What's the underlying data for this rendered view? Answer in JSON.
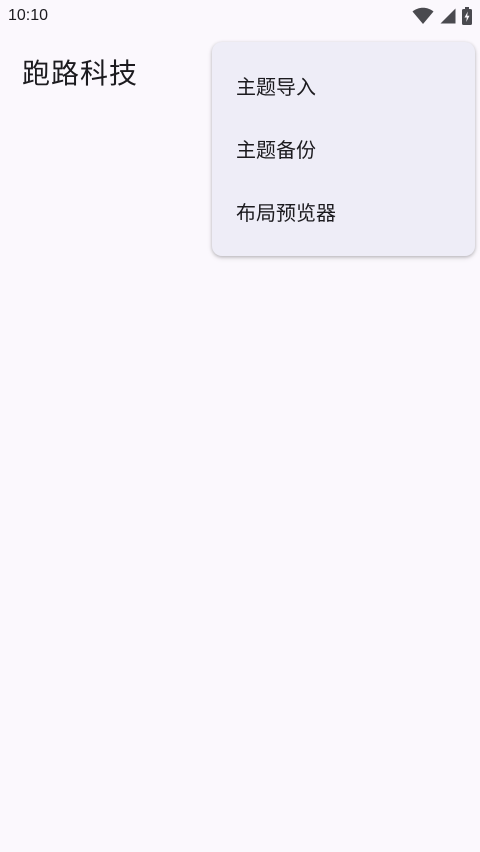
{
  "status_bar": {
    "time": "10:10",
    "icons": [
      "wifi-icon",
      "cellular-signal-icon",
      "battery-charging-icon"
    ]
  },
  "app_bar": {
    "title": "跑路科技"
  },
  "overflow_menu": {
    "items": [
      {
        "label": "主题导入"
      },
      {
        "label": "主题备份"
      },
      {
        "label": "布局预览器"
      }
    ]
  },
  "colors": {
    "background": "#fbf8fd",
    "menu_surface": "#eeedf7",
    "text": "#1c1b1f"
  }
}
